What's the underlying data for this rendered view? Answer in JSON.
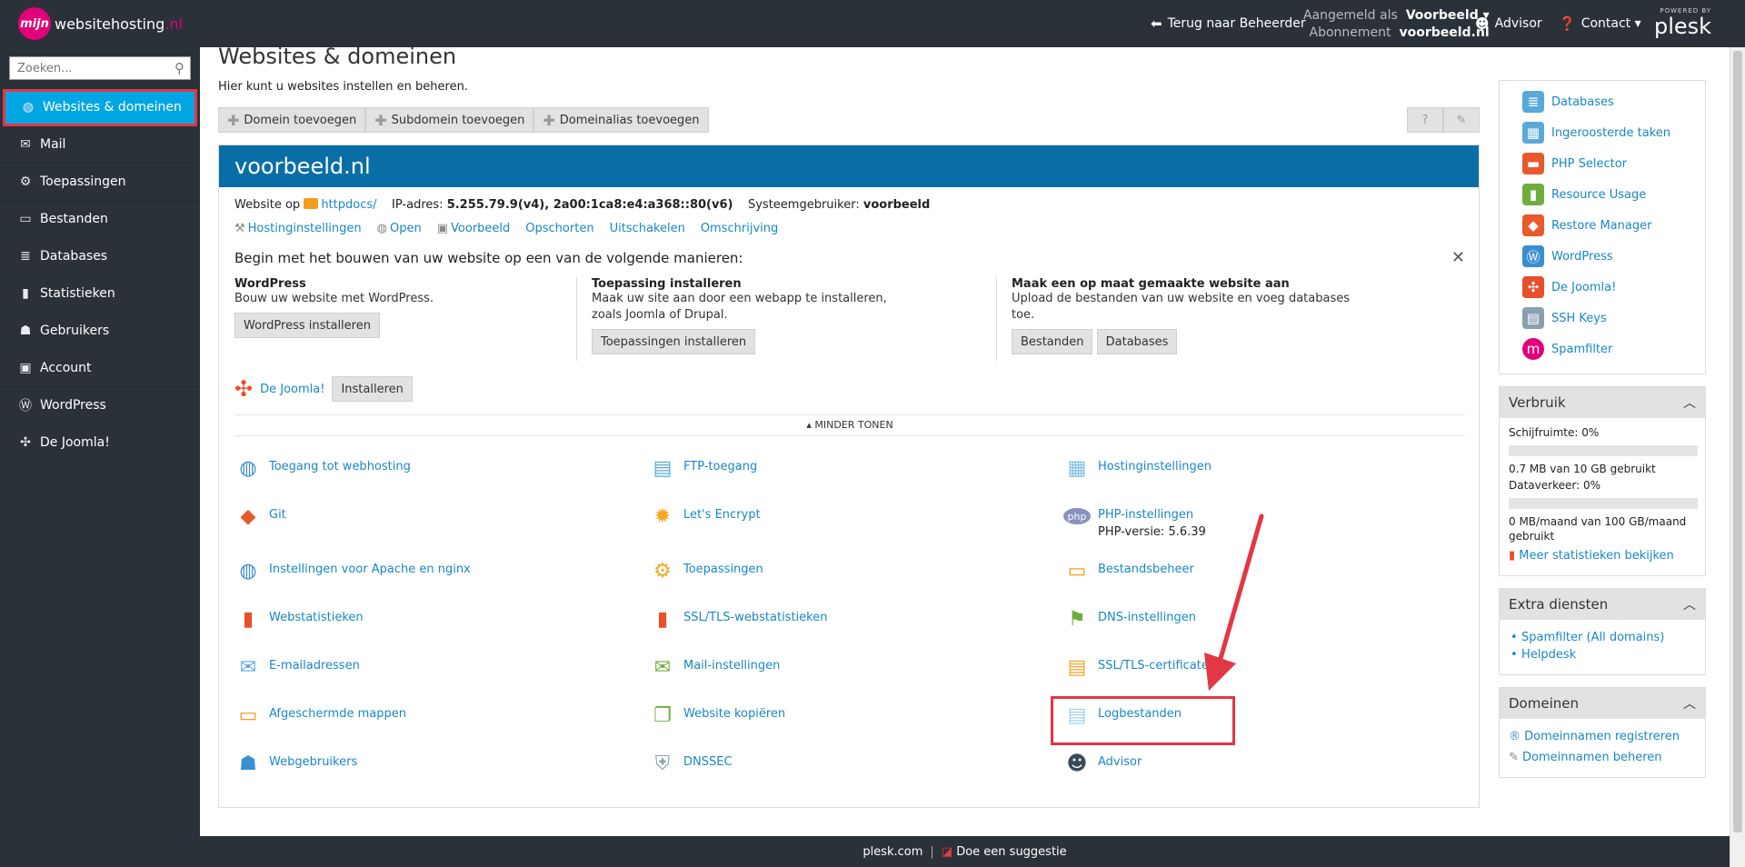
{
  "topbar": {
    "logo_mark": "mijn",
    "logo_name": "websitehosting",
    "logo_tld": ".nl",
    "back_label": "Terug naar Beheerder",
    "logged_in_label": "Aangemeld als",
    "logged_in_user": "Voorbeeld",
    "subscription_label": "Abonnement",
    "subscription_value": "voorbeeld.nl",
    "advisor_label": "Advisor",
    "contact_label": "Contact",
    "powered_by": "POWERED BY",
    "plesk": "plesk"
  },
  "sidebar": {
    "search_placeholder": "Zoeken...",
    "items": [
      {
        "label": "Websites & domeinen",
        "icon": "globe-icon"
      },
      {
        "label": "Mail",
        "icon": "mail-icon"
      },
      {
        "label": "Toepassingen",
        "icon": "gear-icon"
      },
      {
        "label": "Bestanden",
        "icon": "folder-icon"
      },
      {
        "label": "Databases",
        "icon": "database-icon"
      },
      {
        "label": "Statistieken",
        "icon": "bar-chart-icon"
      },
      {
        "label": "Gebruikers",
        "icon": "user-icon"
      },
      {
        "label": "Account",
        "icon": "account-icon"
      },
      {
        "label": "WordPress",
        "icon": "wordpress-icon"
      },
      {
        "label": "De Joomla!",
        "icon": "joomla-icon"
      }
    ]
  },
  "main": {
    "title": "Websites & domeinen",
    "subtitle": "Hier kunt u websites instellen en beheren.",
    "toolbar": [
      "Domein toevoegen",
      "Subdomein toevoegen",
      "Domeinalias toevoegen"
    ],
    "help_glyph": "?",
    "domain": {
      "name": "voorbeeld.nl",
      "website_on_label": "Website op",
      "website_folder": "httpdocs/",
      "ip_label": "IP-adres:",
      "ip_value": "5.255.79.9(v4), 2a00:1ca8:e4:a368::80(v6)",
      "sysuser_label": "Systeemgebruiker:",
      "sysuser_value": "voorbeeld",
      "actions": [
        "Hostinginstellingen",
        "Open",
        "Voorbeeld",
        "Opschorten",
        "Uitschakelen",
        "Omschrijving"
      ]
    },
    "getstarted": {
      "title": "Begin met het bouwen van uw website op een van de volgende manieren:",
      "columns": [
        {
          "heading": "WordPress",
          "text": "Bouw uw website met WordPress.",
          "buttons": [
            "WordPress installeren"
          ]
        },
        {
          "heading": "Toepassing installeren",
          "text": "Maak uw site aan door een webapp te installeren, zoals Joomla of Drupal.",
          "buttons": [
            "Toepassingen installeren"
          ]
        },
        {
          "heading": "Maak een op maat gemaakte website aan",
          "text": "Upload de bestanden van uw website en voeg databases toe.",
          "buttons": [
            "Bestanden",
            "Databases"
          ]
        }
      ]
    },
    "joomla": {
      "label": "De Joomla!",
      "button": "Installeren"
    },
    "less_label": "MINDER TONEN",
    "tools": [
      {
        "label": "Toegang tot webhosting",
        "icon": "webhosting-access-icon",
        "color": "#3b8ed1"
      },
      {
        "label": "FTP-toegang",
        "icon": "ftp-icon",
        "color": "#5aa9d9"
      },
      {
        "label": "Hostinginstellingen",
        "icon": "hosting-settings-icon",
        "color": "#7cbde8"
      },
      {
        "label": "Git",
        "icon": "git-icon",
        "color": "#e8592b"
      },
      {
        "label": "Let's Encrypt",
        "icon": "letsencrypt-icon",
        "color": "#f5a623"
      },
      {
        "label": "PHP-instellingen",
        "icon": "php-icon",
        "color": "#8892be",
        "sub": "PHP-versie: 5.6.39"
      },
      {
        "label": "Instellingen voor Apache en nginx",
        "icon": "apache-nginx-icon",
        "color": "#3b8ed1"
      },
      {
        "label": "Toepassingen",
        "icon": "applications-icon",
        "color": "#f5a623"
      },
      {
        "label": "Bestandsbeheer",
        "icon": "file-manager-icon",
        "color": "#f59b1e"
      },
      {
        "label": "Webstatistieken",
        "icon": "web-stats-icon",
        "color": "#e84f2a"
      },
      {
        "label": "SSL/TLS-webstatistieken",
        "icon": "ssl-stats-icon",
        "color": "#e84f2a"
      },
      {
        "label": "DNS-instellingen",
        "icon": "dns-icon",
        "color": "#6fae3e"
      },
      {
        "label": "E-mailadressen",
        "icon": "email-icon",
        "color": "#5aa9d9"
      },
      {
        "label": "Mail-instellingen",
        "icon": "mail-settings-icon",
        "color": "#6fae3e"
      },
      {
        "label": "SSL/TLS-certificaten",
        "icon": "certificate-icon",
        "color": "#f5a623"
      },
      {
        "label": "Afgeschermde mappen",
        "icon": "protected-folder-icon",
        "color": "#f59b1e"
      },
      {
        "label": "Website kopiëren",
        "icon": "copy-site-icon",
        "color": "#6fae3e"
      },
      {
        "label": "Logbestanden",
        "icon": "log-files-icon",
        "color": "#9fd0ef"
      },
      {
        "label": "Webgebruikers",
        "icon": "web-users-icon",
        "color": "#3b8ed1"
      },
      {
        "label": "DNSSEC",
        "icon": "dnssec-icon",
        "color": "#8aa0b0"
      },
      {
        "label": "Advisor",
        "icon": "advisor-icon",
        "color": "#3a4a5a"
      }
    ]
  },
  "right": {
    "quick_links": [
      {
        "label": "Databases",
        "icon": "database-icon",
        "color": "#5aa9d9"
      },
      {
        "label": "Ingeroosterde taken",
        "icon": "calendar-icon",
        "color": "#5aa9d9"
      },
      {
        "label": "PHP Selector",
        "icon": "php-selector-icon",
        "color": "#e8592b"
      },
      {
        "label": "Resource Usage",
        "icon": "resource-usage-icon",
        "color": "#6fae3e"
      },
      {
        "label": "Restore Manager",
        "icon": "restore-manager-icon",
        "color": "#e8592b"
      },
      {
        "label": "WordPress",
        "icon": "wordpress-icon",
        "color": "#3b8ed1"
      },
      {
        "label": "De Joomla!",
        "icon": "joomla-icon",
        "color": "#e84f2a"
      },
      {
        "label": "SSH Keys",
        "icon": "ssh-keys-icon",
        "color": "#8aa0b0"
      },
      {
        "label": "Spamfilter",
        "icon": "spamfilter-icon",
        "color": "#e2007a"
      }
    ],
    "usage": {
      "title": "Verbruik",
      "disk_label": "Schijfruimte:",
      "disk_pct": "0%",
      "disk_used": "0.7 MB van 10 GB gebruikt",
      "traffic_label": "Dataverkeer:",
      "traffic_pct": "0%",
      "traffic_used": "0 MB/maand van 100 GB/maand gebruikt",
      "more_stats": "Meer statistieken bekijken"
    },
    "extra": {
      "title": "Extra diensten",
      "links": [
        "Spamfilter (All domains)",
        "Helpdesk"
      ]
    },
    "domains": {
      "title": "Domeinen",
      "links": [
        "Domeinnamen registreren",
        "Domeinnamen beheren"
      ]
    }
  },
  "footer": {
    "plesk_link": "plesk.com",
    "separator": "|",
    "suggest": "Doe een suggestie"
  }
}
